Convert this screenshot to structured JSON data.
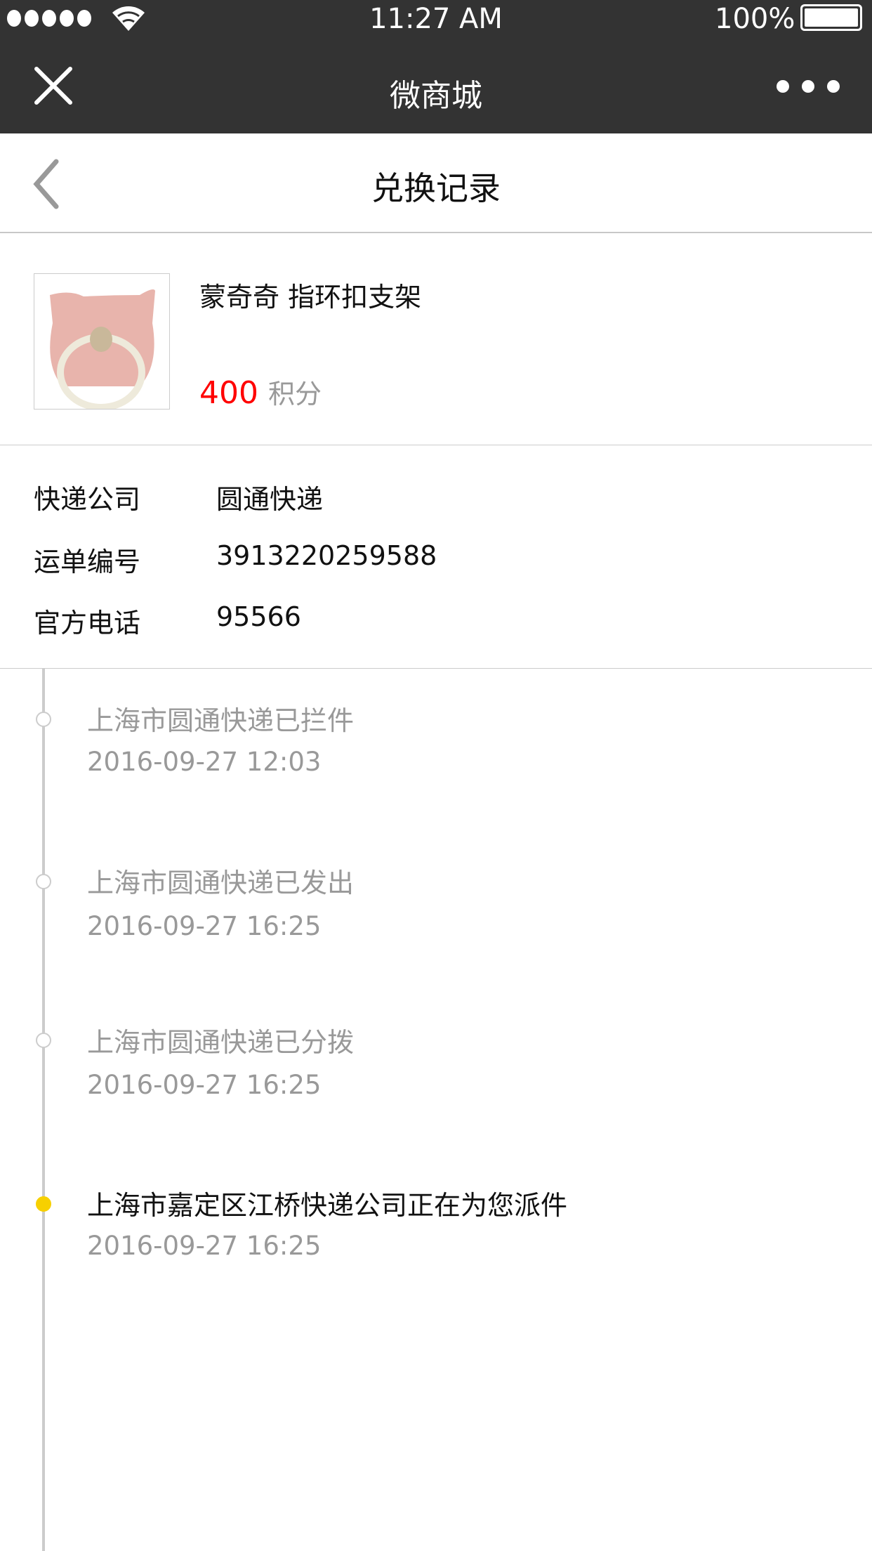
{
  "status_bar": {
    "time": "11:27 AM",
    "battery": "100%",
    "signal_dots": 5
  },
  "nav": {
    "title": "微商城",
    "close_icon": "close-icon",
    "more_icon": "more-icon"
  },
  "header": {
    "title": "兑换记录",
    "back_icon": "chevron-left-icon"
  },
  "product": {
    "name": "蒙奇奇 指环扣支架",
    "points": "400",
    "points_unit": "积分",
    "price_color": "#ff0000"
  },
  "shipping": [
    {
      "label": "快递公司",
      "value": "圆通快递"
    },
    {
      "label": "运单编号",
      "value": "3913220259588"
    },
    {
      "label": "官方电话",
      "value": "95566"
    }
  ],
  "timeline": [
    {
      "text": "上海市圆通快递已拦件",
      "time": "2016-09-27 12:03",
      "active": false
    },
    {
      "text": "上海市圆通快递已发出",
      "time": "2016-09-27 16:25",
      "active": false
    },
    {
      "text": "上海市圆通快递已分拨",
      "time": "2016-09-27 16:25",
      "active": false
    },
    {
      "text": "上海市嘉定区江桥快递公司正在为您派件",
      "time": "2016-09-27 16:25",
      "active": true
    }
  ],
  "colors": {
    "active_dot": "#f7d000",
    "nav_bg": "#333333"
  }
}
